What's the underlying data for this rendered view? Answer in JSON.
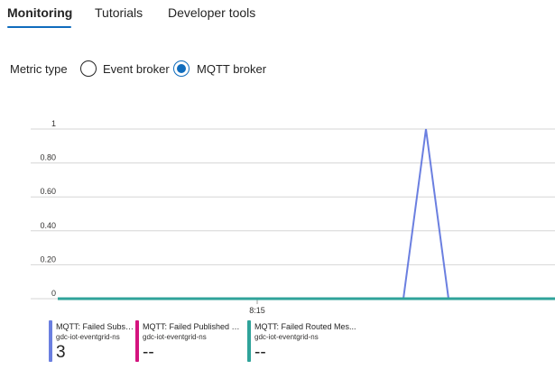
{
  "tabs": [
    {
      "label": "Monitoring",
      "active": true
    },
    {
      "label": "Tutorials",
      "active": false
    },
    {
      "label": "Developer tools",
      "active": false
    }
  ],
  "metric_type": {
    "label": "Metric type",
    "options": [
      {
        "label": "Event broker",
        "selected": false
      },
      {
        "label": "MQTT broker",
        "selected": true
      }
    ]
  },
  "colors": {
    "accent": "#0f6cbd",
    "series_blue": "#6b7fe0",
    "series_magenta": "#d4147e",
    "series_teal": "#2fa39a",
    "grid": "#d6d6d6"
  },
  "chart_data": {
    "type": "line",
    "y_ticks": [
      "1",
      "0.80",
      "0.60",
      "0.40",
      "0.20",
      "0"
    ],
    "ylim": [
      0,
      1
    ],
    "x_ticks": [
      "8:15"
    ],
    "grid": true,
    "series": [
      {
        "name": "MQTT: Failed Subscription...",
        "color": "#6b7fe0",
        "points": [
          {
            "x": "start",
            "y": 0
          },
          {
            "x": "peak-start",
            "y": 0
          },
          {
            "x": "peak",
            "y": 1
          },
          {
            "x": "peak-end",
            "y": 0
          },
          {
            "x": "end",
            "y": 0
          }
        ]
      },
      {
        "name": "MQTT: Failed Published M...",
        "color": "#d4147e",
        "points": [
          {
            "x": "start",
            "y": 0
          },
          {
            "x": "end",
            "y": 0
          }
        ]
      },
      {
        "name": "MQTT: Failed Routed Mes...",
        "color": "#2fa39a",
        "points": [
          {
            "x": "start",
            "y": 0
          },
          {
            "x": "end",
            "y": 0
          }
        ]
      }
    ]
  },
  "legend": [
    {
      "name": "MQTT: Failed Subscription...",
      "resource": "gdc-iot-eventgrid-ns",
      "value": "3",
      "color": "#6b7fe0"
    },
    {
      "name": "MQTT: Failed Published M...",
      "resource": "gdc-iot-eventgrid-ns",
      "value": "--",
      "color": "#d4147e"
    },
    {
      "name": "MQTT: Failed Routed Mes...",
      "resource": "gdc-iot-eventgrid-ns",
      "value": "--",
      "color": "#2fa39a"
    }
  ]
}
